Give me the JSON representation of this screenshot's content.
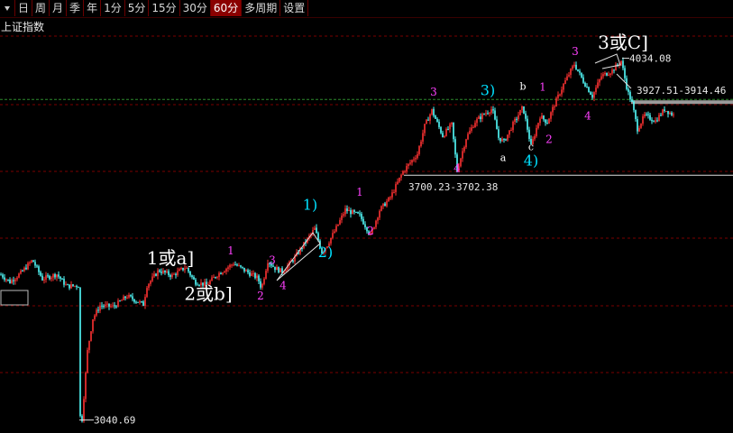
{
  "toolbar": {
    "buttons": [
      {
        "label": "日"
      },
      {
        "label": "周"
      },
      {
        "label": "月"
      },
      {
        "label": "季"
      },
      {
        "label": "年"
      },
      {
        "label": "1分"
      },
      {
        "label": "5分"
      },
      {
        "label": "15分"
      },
      {
        "label": "30分"
      },
      {
        "label": "60分",
        "active": true
      },
      {
        "label": "多周期"
      },
      {
        "label": "设置"
      }
    ]
  },
  "title": "上证指数",
  "colors": {
    "up": "#ff3232",
    "down": "#54ffff",
    "wave_magenta": "#ff40ff",
    "wave_cyan": "#00e0ff",
    "wave_white": "#ffffff",
    "grid": "#7a0000",
    "guide_green": "#2e8b2e",
    "ref_line": "#dddddd"
  },
  "chart_data": {
    "type": "candlestick",
    "y_range": [
      3010,
      4090
    ],
    "price_labels": [
      {
        "text": "4034.08",
        "value": 4034.08
      },
      {
        "text": "3927.51-3914.46",
        "value": 3921
      },
      {
        "text": "3700.23-3702.38",
        "value": 3701.3
      },
      {
        "text": "3040.69",
        "value": 3040.69
      }
    ],
    "horizontal_levels": [
      {
        "value": 3921,
        "style": "green-dashed"
      },
      {
        "value": 3713,
        "style": "solid-white"
      }
    ],
    "wave_labels": [
      {
        "text": "1",
        "color": "magenta",
        "bar": 255,
        "price": 3495
      },
      {
        "text": "2",
        "color": "magenta",
        "bar": 288,
        "price": 3372
      },
      {
        "text": "3",
        "color": "magenta",
        "bar": 301,
        "price": 3470
      },
      {
        "text": "4",
        "color": "magenta",
        "bar": 313,
        "price": 3400
      },
      {
        "text": "1)",
        "color": "cyan",
        "bar": 343,
        "price": 3618
      },
      {
        "text": "2)",
        "color": "cyan",
        "bar": 360,
        "price": 3488
      },
      {
        "text": "1",
        "color": "magenta",
        "bar": 398,
        "price": 3656
      },
      {
        "text": "2",
        "color": "magenta",
        "bar": 410,
        "price": 3550
      },
      {
        "text": "3",
        "color": "magenta",
        "bar": 480,
        "price": 3932
      },
      {
        "text": "4",
        "color": "magenta",
        "bar": 506,
        "price": 3722
      },
      {
        "text": "3)",
        "color": "cyan",
        "bar": 540,
        "price": 3933
      },
      {
        "text": "a",
        "color": "white",
        "bar": 557,
        "price": 3752
      },
      {
        "text": "b",
        "color": "white",
        "bar": 579,
        "price": 3947
      },
      {
        "text": "c",
        "color": "white",
        "bar": 588,
        "price": 3782
      },
      {
        "text": "4)",
        "color": "cyan",
        "bar": 588,
        "price": 3740
      },
      {
        "text": "1",
        "color": "magenta",
        "bar": 601,
        "price": 3945
      },
      {
        "text": "2",
        "color": "magenta",
        "bar": 608,
        "price": 3802
      },
      {
        "text": "3",
        "color": "magenta",
        "bar": 637,
        "price": 4043
      },
      {
        "text": "4",
        "color": "magenta",
        "bar": 651,
        "price": 3866
      },
      {
        "text": "1或a]",
        "color": "white",
        "bar": 188,
        "price": 3468
      },
      {
        "text": "2或b]",
        "color": "white",
        "bar": 230,
        "price": 3370
      },
      {
        "text": "3或C]",
        "color": "white",
        "bar": 690,
        "price": 4060
      }
    ],
    "waypoints": [
      [
        0,
        3440
      ],
      [
        10,
        3420
      ],
      [
        22,
        3444
      ],
      [
        35,
        3480
      ],
      [
        46,
        3428
      ],
      [
        62,
        3441
      ],
      [
        73,
        3408
      ],
      [
        86,
        3410
      ],
      [
        88,
        3050
      ],
      [
        90,
        3043
      ],
      [
        96,
        3230
      ],
      [
        102,
        3320
      ],
      [
        110,
        3355
      ],
      [
        125,
        3352
      ],
      [
        140,
        3381
      ],
      [
        158,
        3358
      ],
      [
        162,
        3410
      ],
      [
        175,
        3452
      ],
      [
        190,
        3437
      ],
      [
        205,
        3461
      ],
      [
        215,
        3420
      ],
      [
        228,
        3412
      ],
      [
        240,
        3440
      ],
      [
        258,
        3471
      ],
      [
        270,
        3452
      ],
      [
        285,
        3430
      ],
      [
        289,
        3402
      ],
      [
        296,
        3478
      ],
      [
        304,
        3458
      ],
      [
        312,
        3448
      ],
      [
        325,
        3484
      ],
      [
        348,
        3566
      ],
      [
        356,
        3502
      ],
      [
        362,
        3522
      ],
      [
        372,
        3568
      ],
      [
        382,
        3618
      ],
      [
        398,
        3602
      ],
      [
        410,
        3548
      ],
      [
        420,
        3617
      ],
      [
        432,
        3652
      ],
      [
        446,
        3723
      ],
      [
        462,
        3772
      ],
      [
        470,
        3848
      ],
      [
        478,
        3891
      ],
      [
        490,
        3821
      ],
      [
        500,
        3852
      ],
      [
        506,
        3725
      ],
      [
        516,
        3815
      ],
      [
        526,
        3860
      ],
      [
        536,
        3881
      ],
      [
        545,
        3896
      ],
      [
        552,
        3816
      ],
      [
        558,
        3805
      ],
      [
        568,
        3853
      ],
      [
        579,
        3900
      ],
      [
        588,
        3792
      ],
      [
        598,
        3875
      ],
      [
        606,
        3858
      ],
      [
        612,
        3896
      ],
      [
        624,
        3962
      ],
      [
        636,
        4018
      ],
      [
        646,
        3971
      ],
      [
        656,
        3930
      ],
      [
        666,
        3985
      ],
      [
        678,
        4000
      ],
      [
        688,
        4027
      ],
      [
        695,
        3944
      ],
      [
        700,
        3911
      ],
      [
        706,
        3840
      ],
      [
        714,
        3877
      ],
      [
        726,
        3862
      ],
      [
        736,
        3894
      ],
      [
        746,
        3878
      ]
    ]
  }
}
